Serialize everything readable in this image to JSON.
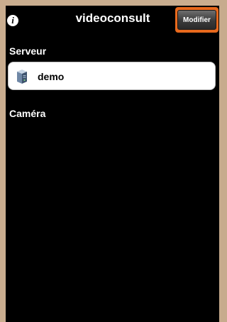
{
  "navbar": {
    "title": "videoconsult",
    "info_icon_glyph": "i",
    "modify_label": "Modifier",
    "highlight_color": "#e8691d"
  },
  "sections": {
    "server_header": "Serveur",
    "camera_header": "Caméra"
  },
  "servers": [
    {
      "label": "demo",
      "icon": "server-icon"
    }
  ]
}
